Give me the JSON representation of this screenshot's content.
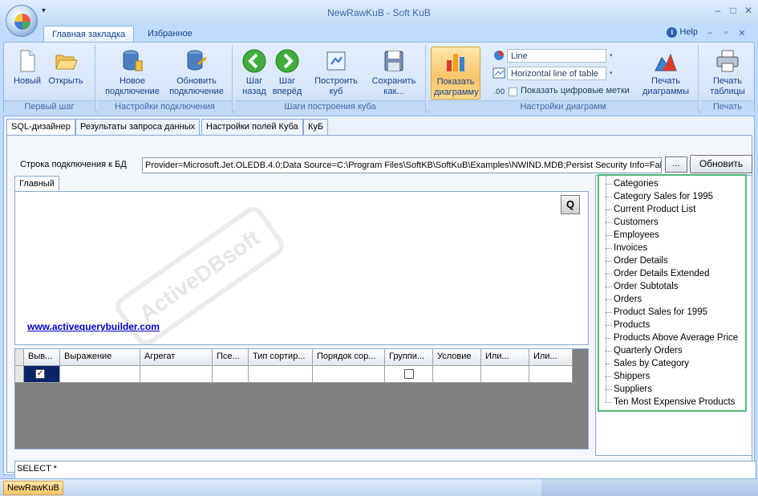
{
  "window": {
    "title": "NewRawKuB - Soft KuB",
    "qat_arrow": "▾",
    "controls": [
      "–",
      "□",
      "✕"
    ]
  },
  "ribbon": {
    "tabs": [
      "Главная закладка",
      "Избранное"
    ],
    "help_label": "Help",
    "sub_controls": [
      "–",
      "▫",
      "✕"
    ],
    "groups": [
      {
        "label": "Первый шаг",
        "buttons": [
          "Новый",
          "Открыть"
        ]
      },
      {
        "label": "Настройки подключения",
        "buttons": [
          "Новое подключение",
          "Обновить подключение"
        ]
      },
      {
        "label": "Шаги построения куба",
        "buttons": [
          "Шаг назад",
          "Шаг вперёд",
          "Построить куб",
          "Сохранить как..."
        ]
      },
      {
        "label": "Настройки диаграмм",
        "buttons": [
          "Показать диаграмму",
          "Печать диаграммы"
        ]
      },
      {
        "label": "Печать",
        "buttons": [
          "Печать таблицы"
        ]
      }
    ],
    "new_label_1": "Новый",
    "open_label_1": "Открыть",
    "new_conn_l1": "Новое",
    "new_conn_l2": "подключение",
    "upd_conn_l1": "Обновить",
    "upd_conn_l2": "подключение",
    "back_l1": "Шаг",
    "back_l2": "назад",
    "fwd_l1": "Шаг",
    "fwd_l2": "вперёд",
    "build_l1": "Построить",
    "build_l2": "куб",
    "save_l1": "Сохранить",
    "save_l2": "как...",
    "show_l1": "Показать",
    "show_l2": "диаграмму",
    "print_chart_l1": "Печать",
    "print_chart_l2": "диаграммы",
    "print_table_l1": "Печать",
    "print_table_l2": "таблицы",
    "chart_type_value": "Line",
    "chart_line_value": "Horizontal line of table",
    "show_labels": "Показать цифровые метки",
    "dropdown_arrow": "▾"
  },
  "tabs": [
    "SQL-дизайнер",
    "Результаты запроса данных",
    "Настройки полей Куба",
    "КуБ"
  ],
  "connection": {
    "label": "Строка подключения к БД",
    "value": "Provider=Microsoft.Jet.OLEDB.4.0;Data Source=C:\\Program Files\\SoftKB\\SoftKuB\\Examples\\NWIND.MDB;Persist Security Info=False",
    "dots_button": "...",
    "refresh_button": "Обновить"
  },
  "designer": {
    "inner_tab": "Главный",
    "q_button": "Q",
    "link": "www.activequerybuilder.com",
    "watermark": "ActiveDBsoft"
  },
  "grid": {
    "columns": [
      "Выв...",
      "Выражение",
      "Агрегат",
      "Псе...",
      "Тип сортир...",
      "Порядок сор...",
      "Группи...",
      "Условие",
      "Или...",
      "Или..."
    ],
    "check_mark": "✓"
  },
  "tables": [
    "Categories",
    "Category Sales for 1995",
    "Current Product List",
    "Customers",
    "Employees",
    "Invoices",
    "Order Details",
    "Order Details Extended",
    "Order Subtotals",
    "Orders",
    "Product Sales for 1995",
    "Products",
    "Products Above Average Price",
    "Quarterly Orders",
    "Sales by Category",
    "Shippers",
    "Suppliers",
    "Ten Most Expensive Products"
  ],
  "sql": "SELECT *",
  "status": {
    "tab": "NewRawKuB"
  }
}
